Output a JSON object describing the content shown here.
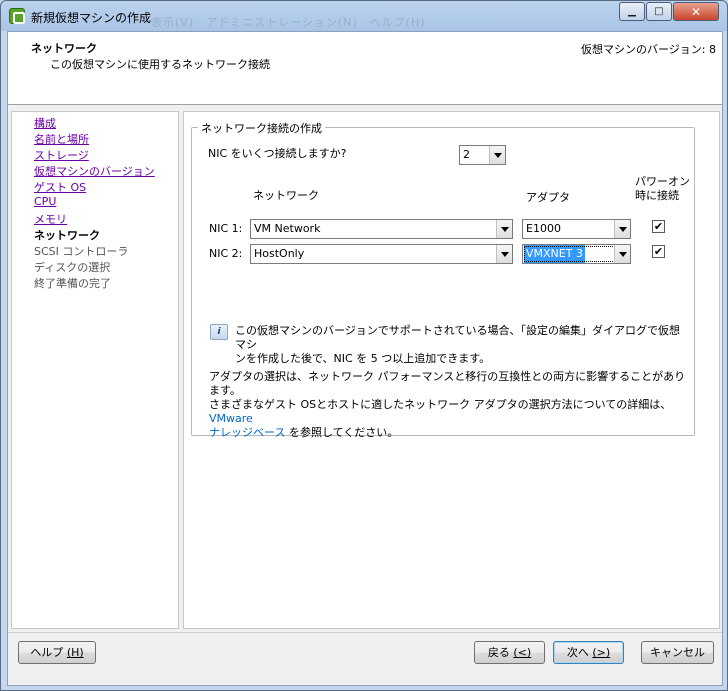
{
  "window": {
    "title": "新規仮想マシンの作成",
    "ghost_menu": "表示(V)　アドミニストレーション(N)　ヘルプ(H)"
  },
  "header": {
    "title": "ネットワーク",
    "subtitle": "この仮想マシンに使用するネットワーク接続",
    "version_label": "仮想マシンのバージョン: 8"
  },
  "nav": {
    "items": [
      {
        "label": "構成",
        "state": "link"
      },
      {
        "label": "名前と場所",
        "state": "link"
      },
      {
        "label": "ストレージ",
        "state": "link"
      },
      {
        "label": "仮想マシンのバージョン",
        "state": "link"
      },
      {
        "label": "ゲスト OS",
        "state": "link"
      },
      {
        "label": "CPU",
        "state": "link"
      },
      {
        "label": "メモリ",
        "state": "link"
      },
      {
        "label": "ネットワーク",
        "state": "current"
      },
      {
        "label": "SCSI コントローラ",
        "state": "future"
      },
      {
        "label": "ディスクの選択",
        "state": "future"
      },
      {
        "label": "終了準備の完了",
        "state": "future"
      }
    ]
  },
  "network": {
    "group_title": "ネットワーク接続の作成",
    "nic_count_question": "NIC をいくつ接続しますか?",
    "nic_count_value": "2",
    "col_network": "ネットワーク",
    "col_adapter": "アダプタ",
    "col_power_on_line1": "パワーオン",
    "col_power_on_line2": "時に接続",
    "nics": [
      {
        "label": "NIC 1:",
        "network": "VM Network",
        "adapter": "E1000",
        "connect_at_power_on": "✔"
      },
      {
        "label": "NIC 2:",
        "network": "HostOnly",
        "adapter": "VMXNET 3",
        "connect_at_power_on": "✔"
      }
    ],
    "info_line1": "この仮想マシンのバージョンでサポートされている場合、「設定の編集」ダイアログで仮想マシ",
    "info_line2": "ンを作成した後で、NIC を 5 つ以上追加できます。",
    "adapter_line1": "アダプタの選択は、ネットワーク パフォーマンスと移行の互換性との両方に影響することがあります。",
    "adapter_line2_text": "さまざまなゲスト OSとホストに適したネットワーク アダプタの選択方法についての詳細は、",
    "adapter_link_part1": "VMware",
    "adapter_link_part2": "ナレッジベース",
    "adapter_line3_tail": " を参照してください。"
  },
  "footer": {
    "help_label": "ヘルプ",
    "help_key": "(H)",
    "back_label": "戻る",
    "back_key": "(<)",
    "next_label": "次へ",
    "next_key": "(>)",
    "cancel_label": "キャンセル"
  }
}
